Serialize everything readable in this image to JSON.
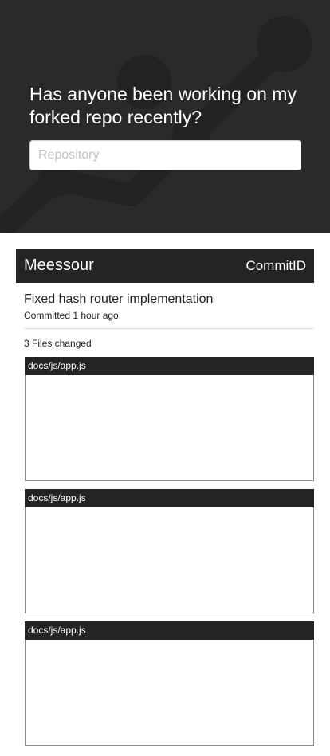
{
  "hero": {
    "title": "Has anyone been working on my forked repo recently?",
    "search_placeholder": "Repository",
    "search_value": ""
  },
  "commit": {
    "author": "Meessour",
    "commit_id_label": "CommitID",
    "message": "Fixed hash router implementation",
    "time": "Committed 1 hour ago",
    "files_changed": "3 Files changed",
    "files": [
      {
        "path": "docs/js/app.js"
      },
      {
        "path": "docs/js/app.js"
      },
      {
        "path": "docs/js/app.js"
      }
    ]
  },
  "colors": {
    "hero_background": "#2a2a2a",
    "header_background": "#242424",
    "text_on_dark": "#ffffff"
  }
}
